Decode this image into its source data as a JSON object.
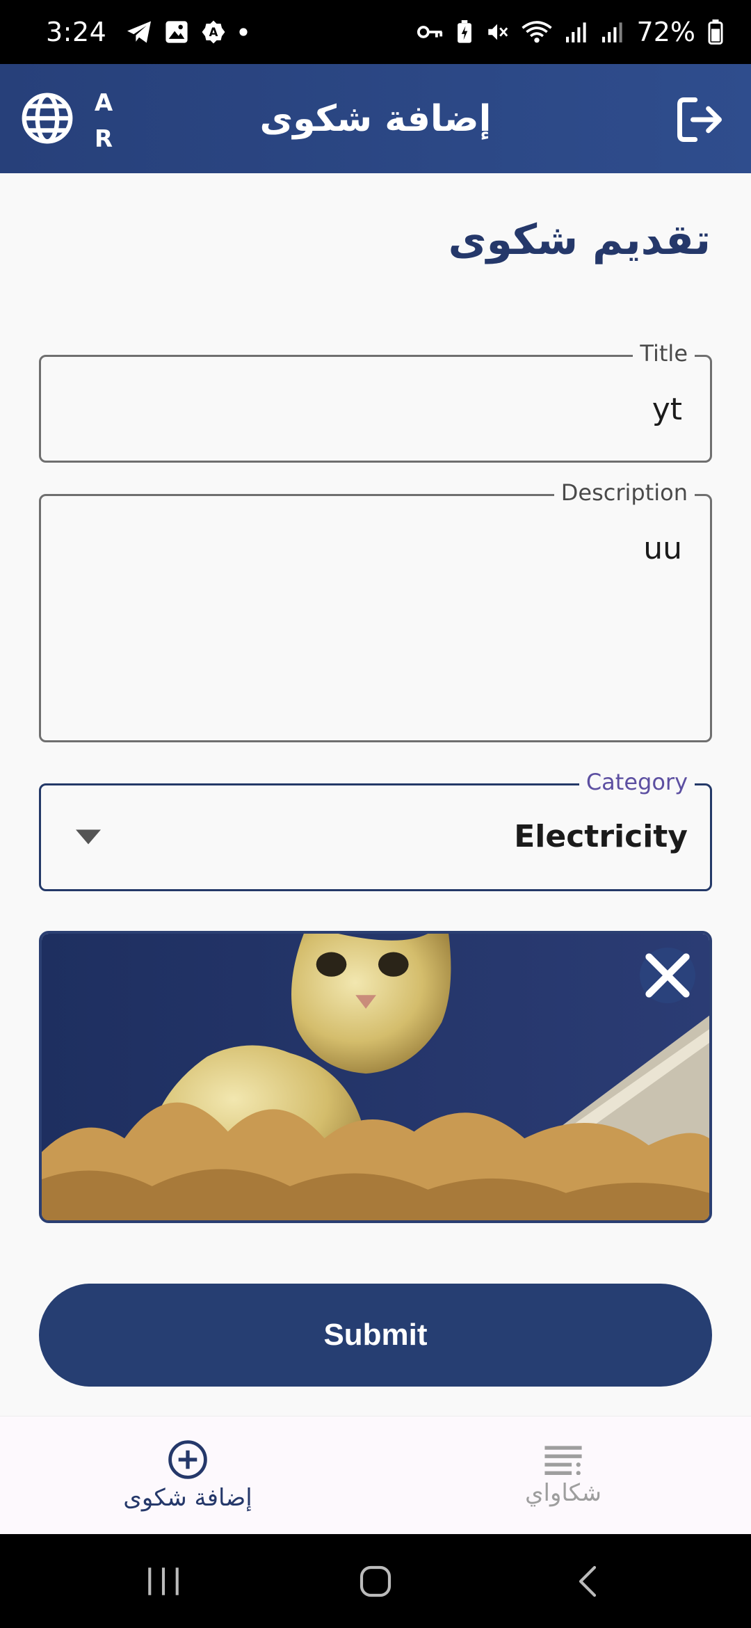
{
  "status_bar": {
    "time": "3:24",
    "battery": "72%",
    "icons_left": [
      "telegram-icon",
      "gallery-icon",
      "settings-badge-icon",
      "dot-icon"
    ],
    "icons_right": [
      "key-icon",
      "battery-saver-icon",
      "mute-icon",
      "wifi-icon",
      "signal-icon",
      "signal-icon",
      "battery-icon"
    ]
  },
  "app_bar": {
    "language_code": "AR",
    "title": "إضافة شكوى",
    "background_color": "#2f4d8d"
  },
  "form": {
    "heading": "تقديم شكوى",
    "title_field": {
      "label": "Title",
      "value": "yt"
    },
    "description_field": {
      "label": "Description",
      "value": "uu"
    },
    "category_field": {
      "label": "Category",
      "value": "Electricity"
    },
    "attachment": {
      "remove_icon": "close-icon"
    },
    "submit_label": "Submit"
  },
  "bottom_nav": {
    "items": [
      {
        "label": "إضافة شكوى",
        "icon": "add-circle-icon",
        "active": true
      },
      {
        "label": "شكاواي",
        "icon": "list-icon",
        "active": false
      }
    ]
  },
  "colors": {
    "primary": "#263e72",
    "accent_label": "#5c4fa1",
    "background": "#f9f9f9"
  }
}
